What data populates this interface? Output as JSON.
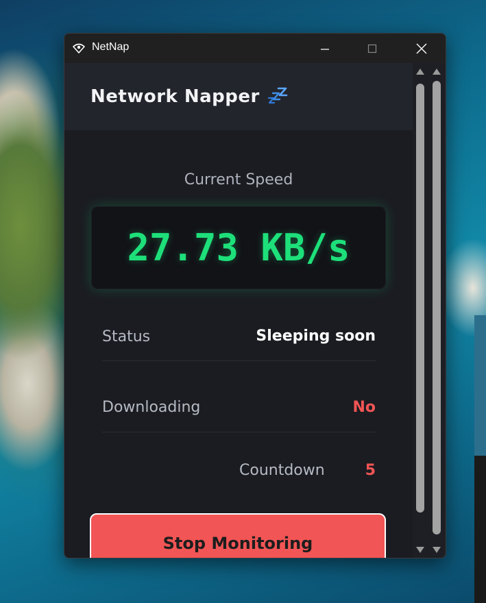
{
  "window": {
    "title": "NetNap",
    "icon": "wifi-eye-icon",
    "minimize_icon": "minimize-icon",
    "maximize_icon": "maximize-icon",
    "close_icon": "close-icon"
  },
  "app": {
    "title": "Network Napper",
    "title_icon": "sleep-zzz-icon"
  },
  "speed": {
    "label": "Current Speed",
    "value": "27.73 KB/s"
  },
  "status_rows": [
    {
      "label": "Status",
      "value": "Sleeping soon"
    },
    {
      "label": "Downloading",
      "value": "No"
    }
  ],
  "countdown": {
    "label": "Countdown",
    "value": "5"
  },
  "actions": {
    "stop_label": "Stop Monitoring"
  },
  "colors": {
    "speed_green": "#1ee07a",
    "alert_red": "#f25555",
    "button_red": "#f25555",
    "background": "#1b1c21"
  }
}
